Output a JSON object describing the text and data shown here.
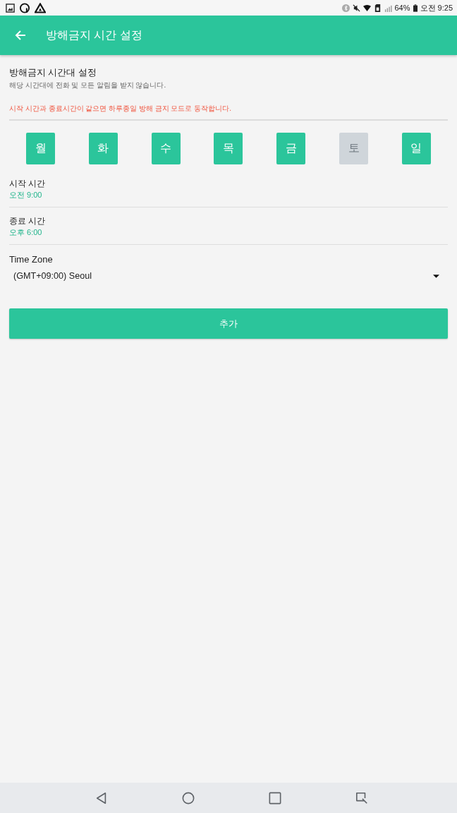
{
  "status_bar": {
    "battery": "64%",
    "time": "오전 9:25"
  },
  "app_bar": {
    "title": "방해금지 시간 설정"
  },
  "section": {
    "title": "방해금지 시간대 설정",
    "description": "해당 시간대에 전화 및 모든 알림을 받지 않습니다.",
    "warning": "시작 시간과 종료시간이 같으면 하루종일 방해 금지 모드로 동작합니다."
  },
  "days": [
    {
      "label": "월",
      "selected": true
    },
    {
      "label": "화",
      "selected": true
    },
    {
      "label": "수",
      "selected": true
    },
    {
      "label": "목",
      "selected": true
    },
    {
      "label": "금",
      "selected": true
    },
    {
      "label": "토",
      "selected": false
    },
    {
      "label": "일",
      "selected": true
    }
  ],
  "times": [
    {
      "label": "시작 시간",
      "value": "오전 9:00"
    },
    {
      "label": "종료 시간",
      "value": "오후 6:00"
    }
  ],
  "time_zone": {
    "label": "Time Zone",
    "value": "(GMT+09:00) Seoul"
  },
  "add_button": {
    "label": "추가"
  }
}
